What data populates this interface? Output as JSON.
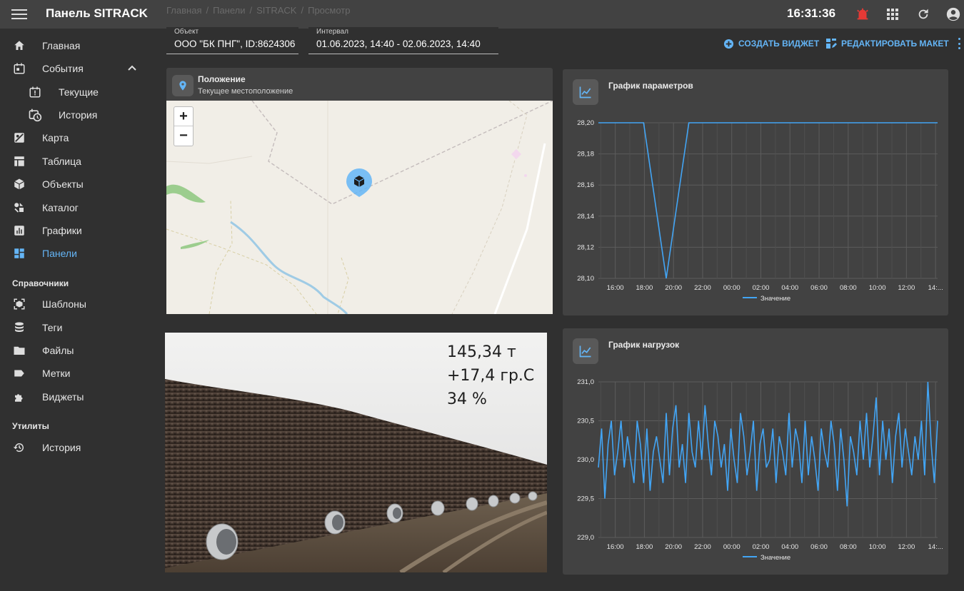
{
  "header": {
    "title": "Панель SITRACK",
    "breadcrumb": [
      "Главная",
      "Панели",
      "SITRACK",
      "Просмотр"
    ],
    "clock": "16:31:36",
    "icons": [
      "menu-icon",
      "alarm-icon",
      "apps-grid-icon",
      "refresh-icon",
      "account-icon"
    ],
    "alarm_color": "#e53935"
  },
  "sidebar": {
    "items": [
      {
        "label": "Главная",
        "icon": "home-icon"
      },
      {
        "label": "События",
        "icon": "events-icon"
      },
      {
        "label": "Текущие",
        "icon": "current-events-icon"
      },
      {
        "label": "История",
        "icon": "history-events-icon"
      },
      {
        "label": "Карта",
        "icon": "map-icon"
      },
      {
        "label": "Таблица",
        "icon": "table-icon"
      },
      {
        "label": "Объекты",
        "icon": "objects-icon"
      },
      {
        "label": "Каталог",
        "icon": "catalog-icon"
      },
      {
        "label": "Графики",
        "icon": "charts-icon"
      },
      {
        "label": "Панели",
        "icon": "dashboard-icon"
      }
    ],
    "section_refs": "Справочники",
    "ref_items": [
      {
        "label": "Шаблоны",
        "icon": "templates-icon"
      },
      {
        "label": "Теги",
        "icon": "tags-icon"
      },
      {
        "label": "Файлы",
        "icon": "folder-icon"
      },
      {
        "label": "Метки",
        "icon": "label-icon"
      },
      {
        "label": "Виджеты",
        "icon": "widgets-icon"
      }
    ],
    "section_utils": "Утилиты",
    "util_items": [
      {
        "label": "История",
        "icon": "history-icon"
      }
    ],
    "active_color": "#64b5f6"
  },
  "toolbar": {
    "object_label": "Объект",
    "object_value": "ООО \"БК ПНГ\", ID:8624306",
    "interval_label": "Интервал",
    "interval_value": "01.06.2023, 14:40 - 02.06.2023, 14:40",
    "create_widget": "СОЗДАТЬ ВИДЖЕТ",
    "edit_layout": "РЕДАКТИРОВАТЬ МАКЕТ"
  },
  "position_widget": {
    "title": "Положение",
    "subtitle": "Текущее местоположение",
    "zoom_in": "+",
    "zoom_out": "−"
  },
  "photo_widget": {
    "lines": [
      "145,34 т",
      "+17,4 гр.С",
      "34 %"
    ]
  },
  "params_widget": {
    "title": "График параметров",
    "legend": "Значение"
  },
  "load_widget": {
    "title": "График нагрузок",
    "legend": "Значение"
  },
  "chart_data": [
    {
      "type": "line",
      "title": "График параметров",
      "x": [
        "16:00",
        "18:00",
        "20:00",
        "22:00",
        "00:00",
        "02:00",
        "04:00",
        "06:00",
        "08:00",
        "10:00",
        "12:00",
        "14:..."
      ],
      "ylim": [
        28.1,
        28.2
      ],
      "yticks": [
        "28,20",
        "28,18",
        "28,16",
        "28,14",
        "28,12",
        "28,10"
      ],
      "series": [
        {
          "name": "Значение",
          "values": [
            28.2,
            28.2,
            28.2,
            28.1,
            28.2,
            28.2,
            28.2,
            28.2,
            28.2,
            28.2,
            28.2,
            28.2,
            28.2,
            28.2,
            28.2,
            28.2
          ]
        }
      ],
      "grid": true,
      "legend": "bottom"
    },
    {
      "type": "line",
      "title": "График нагрузок",
      "x": [
        "16:00",
        "18:00",
        "20:00",
        "22:00",
        "00:00",
        "02:00",
        "04:00",
        "06:00",
        "08:00",
        "10:00",
        "12:00",
        "14:..."
      ],
      "ylim": [
        229.0,
        231.0
      ],
      "yticks": [
        "231,0",
        "230,5",
        "230,0",
        "229,5",
        "229,0"
      ],
      "series": [
        {
          "name": "Значение",
          "values": [
            229.9,
            230.4,
            229.5,
            230.2,
            230.5,
            229.8,
            230.1,
            230.5,
            229.9,
            230.3,
            230.0,
            229.7,
            230.5,
            230.2,
            229.7,
            230.4,
            229.6,
            230.1,
            230.3,
            230.0,
            229.7,
            230.6,
            229.8,
            230.4,
            230.7,
            229.9,
            230.2,
            229.7,
            230.6,
            230.1,
            229.9,
            230.5,
            230.0,
            230.7,
            230.2,
            229.8,
            230.5,
            230.3,
            229.9,
            230.2,
            229.6,
            230.4,
            230.0,
            229.7,
            230.6,
            230.3,
            229.8,
            230.1,
            230.5,
            229.6,
            230.2,
            230.4,
            229.9,
            230.0,
            230.4,
            229.7,
            230.3,
            230.1,
            229.8,
            230.6,
            229.9,
            230.4,
            230.2,
            229.7,
            230.5,
            229.8,
            230.3,
            230.0,
            229.6,
            230.4,
            230.1,
            229.9,
            230.5,
            230.2,
            229.6,
            230.4,
            230.0,
            229.4,
            230.3,
            230.1,
            229.8,
            230.5,
            230.0,
            230.6,
            229.9,
            230.3,
            230.8,
            229.8,
            230.5,
            230.0,
            230.4,
            229.7,
            230.3,
            230.6,
            229.9,
            230.4,
            230.1,
            229.8,
            230.3,
            230.0,
            230.5,
            229.8,
            231.0,
            230.2,
            229.7,
            230.5
          ]
        }
      ],
      "grid": true,
      "legend": "bottom"
    }
  ]
}
